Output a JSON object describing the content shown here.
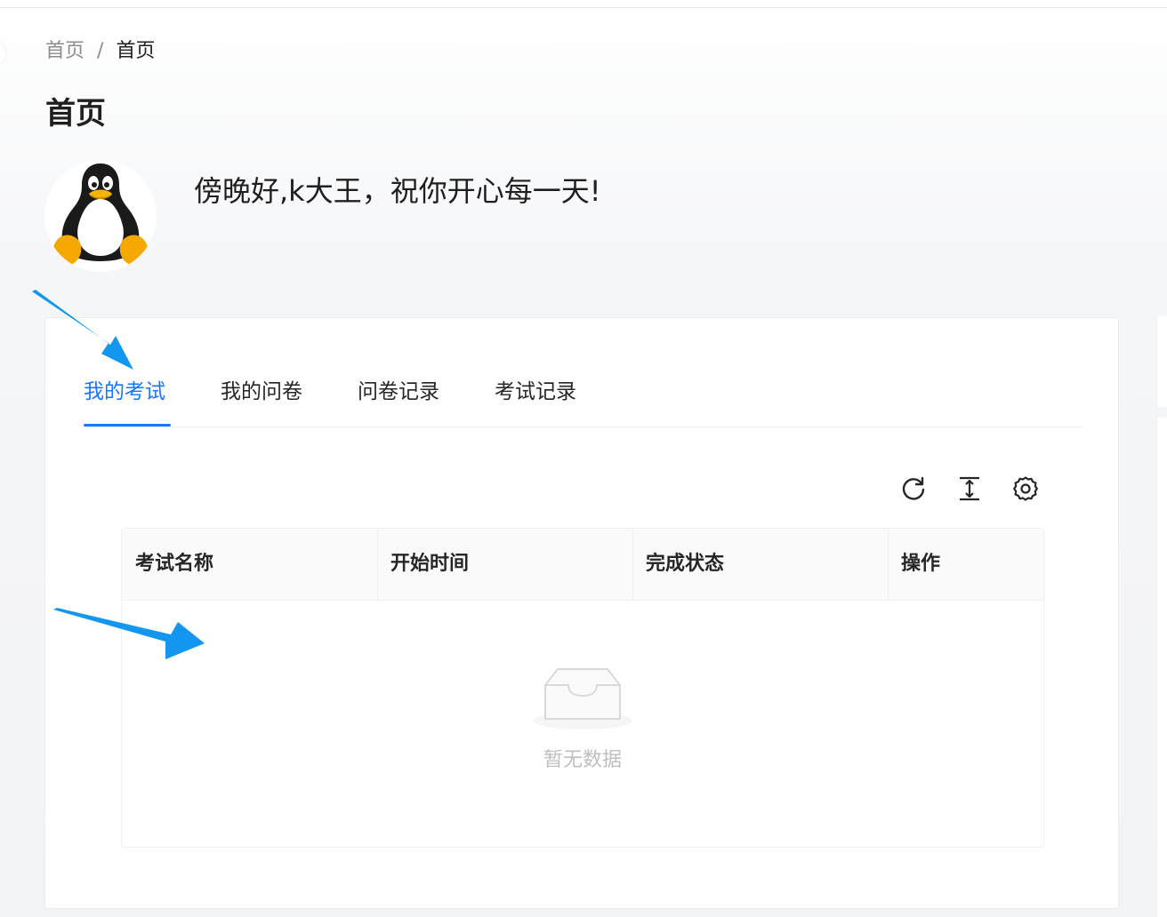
{
  "breadcrumb": {
    "home_label": "首页",
    "separator": "/",
    "current_label": "首页"
  },
  "page_title": "首页",
  "greeting": "傍晚好,k大王，祝你开心每一天!",
  "avatar": {
    "icon": "tux-penguin-icon"
  },
  "tabs": [
    {
      "label": "我的考试",
      "active": true
    },
    {
      "label": "我的问卷",
      "active": false
    },
    {
      "label": "问卷记录",
      "active": false
    },
    {
      "label": "考试记录",
      "active": false
    }
  ],
  "toolbar": {
    "icons": [
      "reload-icon",
      "column-height-icon",
      "setting-icon"
    ]
  },
  "table": {
    "columns": [
      "考试名称",
      "开始时间",
      "完成状态",
      "操作"
    ],
    "rows": [],
    "empty_text": "暂无数据"
  },
  "colors": {
    "accent": "#1677ff",
    "annotation_arrow": "#1296f0",
    "empty_text": "#bfbfbf"
  }
}
